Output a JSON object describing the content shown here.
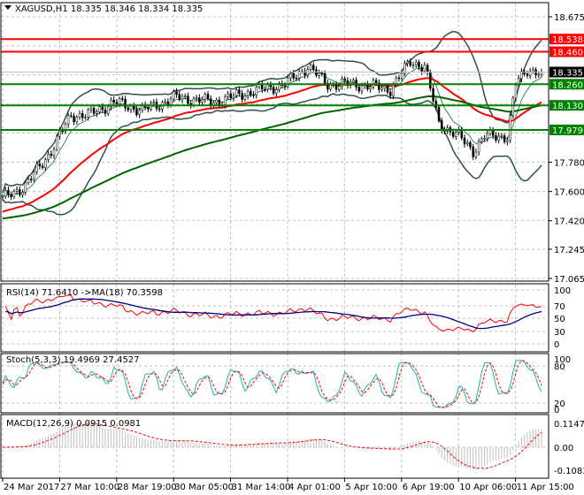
{
  "chart_data": {
    "type": "candlestick",
    "symbol_header": "XAGUSD,H1  18.335 18.346 18.334 18.335",
    "price_ylim": [
      17.065,
      18.675
    ],
    "price_ticks": [
      "18.675",
      "17.780",
      "17.600",
      "17.420",
      "17.245",
      "17.065"
    ],
    "close_anchors": [
      [
        0,
        17.555
      ],
      [
        8,
        17.636
      ],
      [
        17,
        17.85
      ],
      [
        24,
        18.07
      ],
      [
        30,
        18.07
      ],
      [
        39,
        18.15
      ],
      [
        49,
        18.1
      ],
      [
        61,
        18.18
      ],
      [
        74,
        18.15
      ],
      [
        86,
        18.21
      ],
      [
        99,
        18.26
      ],
      [
        107,
        18.37
      ],
      [
        114,
        18.26
      ],
      [
        124,
        18.26
      ],
      [
        136,
        18.23
      ],
      [
        143,
        18.4
      ],
      [
        148,
        18.37
      ],
      [
        153,
        18.02
      ],
      [
        160,
        17.94
      ],
      [
        165,
        17.85
      ],
      [
        169,
        17.94
      ],
      [
        177,
        17.94
      ],
      [
        180,
        18.26
      ],
      [
        184,
        18.35
      ],
      [
        189,
        18.335
      ]
    ],
    "levels": [
      {
        "label": "18.538",
        "value": 18.538,
        "color": "#ff0000"
      },
      {
        "label": "18.460",
        "value": 18.46,
        "color": "#ff0000"
      },
      {
        "label": "18.335",
        "value": 18.335,
        "color": "#000000"
      },
      {
        "label": "18.260",
        "value": 18.26,
        "color": "#008000"
      },
      {
        "label": "18.130",
        "value": 18.13,
        "color": "#008000"
      },
      {
        "label": "17.979",
        "value": 17.979,
        "color": "#008000"
      }
    ],
    "x_labels": [
      "24 Mar 2017",
      "27 Mar 10:00",
      "28 Mar 19:00",
      "30 Mar 05:00",
      "31 Mar 14:00",
      "4 Apr 01:00",
      "5 Apr 10:00",
      "6 Apr 19:00",
      "10 Apr 06:00",
      "11 Apr 15:00"
    ],
    "rsi": {
      "label": "RSI(14) 71.6410  ->MA(18) 70.3598",
      "ticks": [
        "100",
        "70",
        "50",
        "30",
        "0"
      ],
      "ylim": [
        0,
        100
      ]
    },
    "stoch": {
      "label": "Stoch(5,3,3) 19.4969 27.4527",
      "ticks": [
        "100",
        "80",
        "20",
        "0"
      ],
      "ylim": [
        0,
        100
      ]
    },
    "macd": {
      "label": "MACD(12,26,9) 0.0915 0.0981",
      "ticks": [
        "0.1147",
        "0.00",
        "-0.1083"
      ],
      "ylim": [
        -0.1083,
        0.1147
      ]
    },
    "colors": {
      "ma_fast": "#ff0000",
      "ma_slow": "#006400",
      "bands": "#2f4f4f",
      "rsi": "#ff0000",
      "rsi_ma": "#000080",
      "stoch_main": "#20b2aa",
      "stoch_signal": "#ff0000",
      "macd_hist": "#c0c0c0",
      "macd_signal": "#ff0000"
    }
  }
}
